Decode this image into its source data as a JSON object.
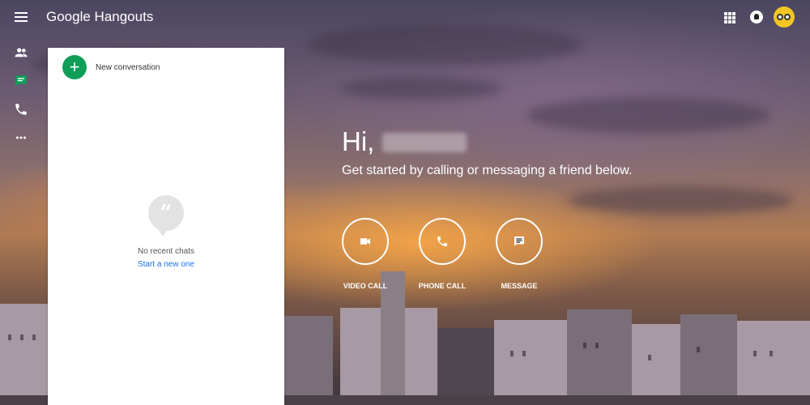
{
  "header": {
    "app_title": "Google Hangouts"
  },
  "rail": {
    "items": [
      {
        "name": "contacts",
        "icon": "people-icon"
      },
      {
        "name": "conversations",
        "icon": "chat-icon",
        "active": true
      },
      {
        "name": "phone-calls",
        "icon": "phone-icon"
      },
      {
        "name": "more",
        "icon": "more-horizontal-icon"
      }
    ]
  },
  "panel": {
    "new_conversation_label": "New conversation",
    "empty_text": "No recent chats",
    "start_link": "Start a new one",
    "bubble_glyph": "“"
  },
  "greeting": {
    "hi": "Hi,",
    "subtitle": "Get started by calling or messaging a friend below."
  },
  "actions": [
    {
      "label": "VIDEO CALL",
      "icon": "videocam-icon"
    },
    {
      "label": "PHONE CALL",
      "icon": "phone-icon"
    },
    {
      "label": "MESSAGE",
      "icon": "message-icon"
    }
  ],
  "colors": {
    "accent_green": "#0f9d58",
    "link_blue": "#1a73e8"
  }
}
